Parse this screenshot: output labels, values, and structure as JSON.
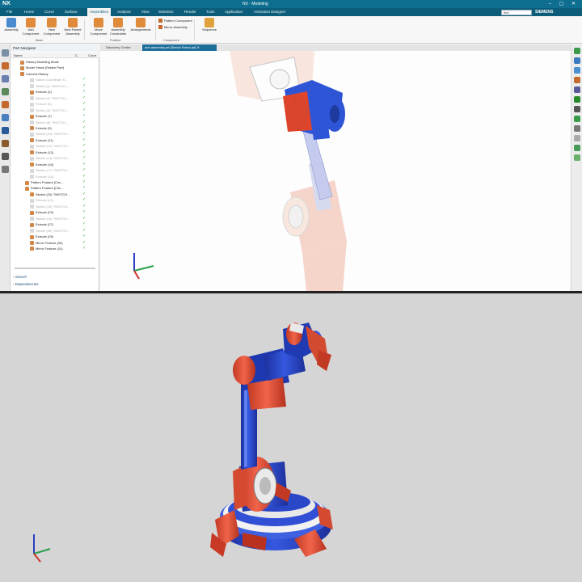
{
  "window": {
    "app_logo": "NX",
    "title": "NX - Modeling",
    "controls": "– ▢ ✕"
  },
  "menu": {
    "items": [
      "File",
      "Home",
      "Curve",
      "Surface",
      "Assemblies",
      "Analysis",
      "View",
      "Selection",
      "Render",
      "Tools",
      "Application",
      "Animation Designer"
    ],
    "active": "Assemblies",
    "search_value": "find",
    "brand": "SIEMENS"
  },
  "ribbon": {
    "buttons": [
      {
        "label": "Assembly",
        "icon": "assembly-icon"
      },
      {
        "label": "Add Component",
        "icon": "add-component-icon"
      },
      {
        "label": "New Component",
        "icon": "new-component-icon"
      },
      {
        "label": "New Parent Assembly",
        "icon": "new-parent-icon"
      },
      {
        "label": "Move Component",
        "icon": "move-component-icon"
      },
      {
        "label": "Assembly Constraints",
        "icon": "constraints-icon"
      },
      {
        "label": "Arrangements",
        "icon": "arrangements-icon"
      },
      {
        "label": "Sequence",
        "icon": "sequence-icon"
      }
    ],
    "small_buttons": [
      "Pattern Component",
      "Mirror Assembly"
    ],
    "groups": [
      "Basic",
      "Position",
      "Component"
    ]
  },
  "navigator": {
    "title": "Part Navigator",
    "columns": [
      "Name",
      "C.",
      "Curre"
    ],
    "rows": [
      {
        "label": "History Modeling Mode",
        "dim": false,
        "indent": 0,
        "check": false
      },
      {
        "label": "Model Views (Sketch Part)",
        "dim": false,
        "indent": 0,
        "check": false
      },
      {
        "label": "Camera History",
        "dim": false,
        "indent": 0,
        "check": false
      },
      {
        "label": "Datum Coordinate S...",
        "dim": true,
        "indent": 2,
        "check": true
      },
      {
        "label": "Sketch (1) \"SKETCH_...",
        "dim": true,
        "indent": 2,
        "check": true
      },
      {
        "label": "Extrude (2)",
        "dim": false,
        "indent": 2,
        "check": true
      },
      {
        "label": "Sketch (3) \"SKETCH_...",
        "dim": true,
        "indent": 2,
        "check": true
      },
      {
        "label": "Extrude (5)",
        "dim": true,
        "indent": 2,
        "check": true
      },
      {
        "label": "Sketch (6) \"SKETCH_...",
        "dim": true,
        "indent": 2,
        "check": true
      },
      {
        "label": "Extrude (7)",
        "dim": false,
        "indent": 2,
        "check": true
      },
      {
        "label": "Sketch (8) \"SKETCH_...",
        "dim": true,
        "indent": 2,
        "check": true
      },
      {
        "label": "Extrude (9)",
        "dim": false,
        "indent": 2,
        "check": true
      },
      {
        "label": "Sketch (10) \"SKETCH...",
        "dim": true,
        "indent": 2,
        "check": true
      },
      {
        "label": "Extrude (11)",
        "dim": false,
        "indent": 2,
        "check": true
      },
      {
        "label": "Sketch (12) \"SKETCH...",
        "dim": true,
        "indent": 2,
        "check": true
      },
      {
        "label": "Extrude (13)",
        "dim": false,
        "indent": 2,
        "check": true
      },
      {
        "label": "Sketch (14) \"SKETCH...",
        "dim": true,
        "indent": 2,
        "check": true
      },
      {
        "label": "Extrude (16)",
        "dim": false,
        "indent": 2,
        "check": true
      },
      {
        "label": "Sketch (17) \"SKETCH...",
        "dim": true,
        "indent": 2,
        "check": true
      },
      {
        "label": "Extrude (18)",
        "dim": true,
        "indent": 2,
        "check": true
      },
      {
        "label": "Pattern Feature [Circ...",
        "dim": false,
        "indent": 1,
        "check": true
      },
      {
        "label": "Pattern Feature [Circ...",
        "dim": false,
        "indent": 1,
        "check": true
      },
      {
        "label": "Sketch (20) \"SKETCH...",
        "dim": false,
        "indent": 2,
        "check": true
      },
      {
        "label": "Extrude (21)",
        "dim": true,
        "indent": 2,
        "check": true
      },
      {
        "label": "Sketch (22) \"SKETCH...",
        "dim": true,
        "indent": 2,
        "check": true
      },
      {
        "label": "Extrude (23)",
        "dim": false,
        "indent": 2,
        "check": true
      },
      {
        "label": "Sketch (24) \"SKETCH...",
        "dim": true,
        "indent": 2,
        "check": true
      },
      {
        "label": "Extrude (27)",
        "dim": false,
        "indent": 2,
        "check": true
      },
      {
        "label": "Sketch (28) \"SKETCH...",
        "dim": true,
        "indent": 2,
        "check": true
      },
      {
        "label": "Extrude (29)",
        "dim": false,
        "indent": 2,
        "check": true
      },
      {
        "label": "Mirror Feature (30)",
        "dim": false,
        "indent": 2,
        "check": true
      },
      {
        "label": "Mirror Feature (31)",
        "dim": false,
        "indent": 2,
        "check": true
      }
    ],
    "footer": [
      "Search",
      "Dependencies"
    ]
  },
  "tabs": [
    {
      "label": "Discovery Center",
      "active": false
    },
    {
      "label": "arm assembly.prt [Sketch Robot.prt] ✕",
      "active": true
    }
  ],
  "colors": {
    "title_bar": "#0e6e8f",
    "menu_bar": "#0b5d7a",
    "robot_red": "#e0533a",
    "robot_blue": "#2f4fd0",
    "render_bg": "#d5d5d5"
  }
}
